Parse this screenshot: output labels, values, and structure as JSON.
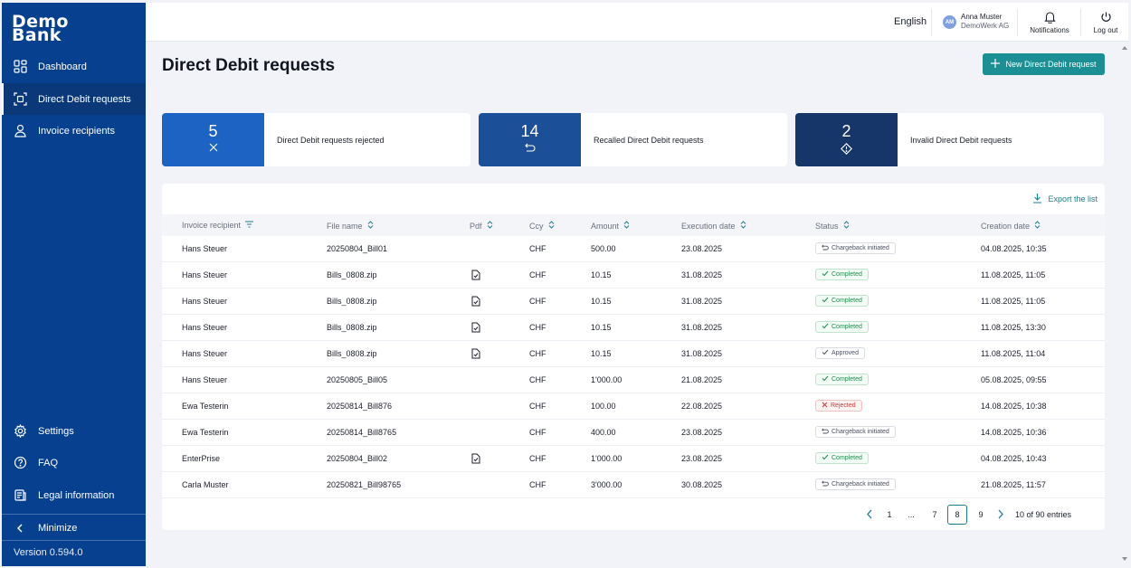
{
  "brand": {
    "line1": "Demo",
    "line2": "Bank"
  },
  "sidebar": {
    "items": [
      {
        "label": "Dashboard",
        "icon": "dashboard-icon"
      },
      {
        "label": "Direct Debit requests",
        "icon": "scan-icon"
      },
      {
        "label": "Invoice recipients",
        "icon": "person-icon"
      }
    ],
    "bottom_items": [
      {
        "label": "Settings",
        "icon": "gear-icon"
      },
      {
        "label": "FAQ",
        "icon": "help-icon"
      },
      {
        "label": "Legal information",
        "icon": "document-icon"
      }
    ],
    "minimize": "Minimize",
    "version": "Version 0.594.0"
  },
  "header": {
    "language": "English",
    "user": {
      "initials": "AM",
      "name": "Anna Muster",
      "company": "DemoWerk AG"
    },
    "notifications": "Notifications",
    "logout": "Log out"
  },
  "main": {
    "title": "Direct Debit requests",
    "new_button": "New Direct Debit request",
    "cards": [
      {
        "count": "5",
        "label": "Direct Debit requests rejected",
        "icon": "close-icon",
        "color": "#1c63c4"
      },
      {
        "count": "14",
        "label": "Recalled Direct Debit requests",
        "icon": "undo-icon",
        "color": "#1b4f98"
      },
      {
        "count": "2",
        "label": "Invalid Direct Debit requests",
        "icon": "warning-diamond-icon",
        "color": "#163568"
      }
    ],
    "export": "Export the list",
    "table": {
      "columns": [
        "Invoice recipient",
        "File name",
        "Pdf",
        "Ccy",
        "Amount",
        "Execution date",
        "Status",
        "Creation date"
      ],
      "rows": [
        {
          "recipient": "Hans Steuer",
          "file": "20250804_Bill01",
          "pdf": false,
          "ccy": "CHF",
          "amount": "500.00",
          "exec": "23.08.2025",
          "status": "Chargeback initiated",
          "status_type": "chargeback",
          "created": "04.08.2025, 10:35"
        },
        {
          "recipient": "Hans Steuer",
          "file": "Bills_0808.zip",
          "pdf": true,
          "ccy": "CHF",
          "amount": "10.15",
          "exec": "31.08.2025",
          "status": "Completed",
          "status_type": "completed",
          "created": "11.08.2025, 11:05"
        },
        {
          "recipient": "Hans Steuer",
          "file": "Bills_0808.zip",
          "pdf": true,
          "ccy": "CHF",
          "amount": "10.15",
          "exec": "31.08.2025",
          "status": "Completed",
          "status_type": "completed",
          "created": "11.08.2025, 11:05"
        },
        {
          "recipient": "Hans Steuer",
          "file": "Bills_0808.zip",
          "pdf": true,
          "ccy": "CHF",
          "amount": "10.15",
          "exec": "31.08.2025",
          "status": "Completed",
          "status_type": "completed",
          "created": "11.08.2025, 13:30"
        },
        {
          "recipient": "Hans Steuer",
          "file": "Bills_0808.zip",
          "pdf": true,
          "ccy": "CHF",
          "amount": "10.15",
          "exec": "31.08.2025",
          "status": "Approved",
          "status_type": "approved",
          "created": "11.08.2025, 11:04"
        },
        {
          "recipient": "Hans Steuer",
          "file": "20250805_Bill05",
          "pdf": false,
          "ccy": "CHF",
          "amount": "1'000.00",
          "exec": "21.08.2025",
          "status": "Completed",
          "status_type": "completed",
          "created": "05.08.2025, 09:55"
        },
        {
          "recipient": "Ewa Testerin",
          "file": "20250814_Bill876",
          "pdf": false,
          "ccy": "CHF",
          "amount": "100.00",
          "exec": "22.08.2025",
          "status": "Rejected",
          "status_type": "rejected",
          "created": "14.08.2025, 10:38"
        },
        {
          "recipient": "Ewa Testerin",
          "file": "20250814_Bill8765",
          "pdf": false,
          "ccy": "CHF",
          "amount": "400.00",
          "exec": "23.08.2025",
          "status": "Chargeback initiated",
          "status_type": "chargeback",
          "created": "14.08.2025, 10:36"
        },
        {
          "recipient": "EnterPrise",
          "file": "20250804_Bill02",
          "pdf": true,
          "ccy": "CHF",
          "amount": "1'000.00",
          "exec": "23.08.2025",
          "status": "Completed",
          "status_type": "completed",
          "created": "04.08.2025, 10:43"
        },
        {
          "recipient": "Carla Muster",
          "file": "20250821_Bill98765",
          "pdf": false,
          "ccy": "CHF",
          "amount": "3'000.00",
          "exec": "30.08.2025",
          "status": "Chargeback initiated",
          "status_type": "chargeback",
          "created": "21.08.2025, 11:57"
        }
      ]
    },
    "pagination": {
      "pages": [
        "1",
        "...",
        "7",
        "8",
        "9"
      ],
      "current": "8",
      "summary": "10 of 90 entries"
    }
  }
}
